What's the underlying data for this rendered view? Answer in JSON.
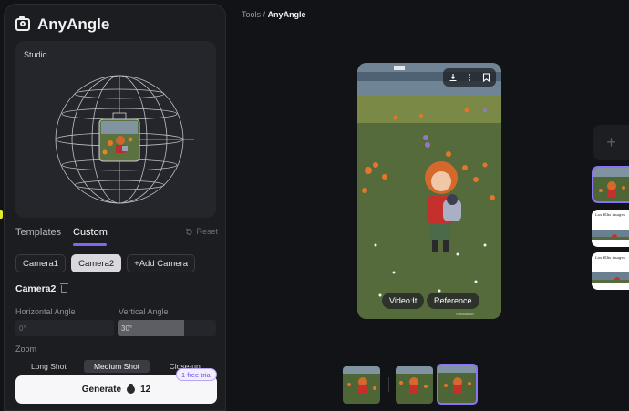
{
  "app": {
    "title": "AnyAngle"
  },
  "studio": {
    "label": "Studio"
  },
  "tabs": [
    {
      "label": "Templates"
    },
    {
      "label": "Custom"
    }
  ],
  "reset_label": "Reset",
  "cameras": [
    {
      "label": "Camera1"
    },
    {
      "label": "Camera2"
    },
    {
      "label": "+Add Camera"
    }
  ],
  "selected_camera": "Camera2",
  "horizontal": {
    "label": "Horizontal Angle",
    "value": "0°"
  },
  "vertical": {
    "label": "Vertical Angle",
    "value": "30°",
    "fill_fraction": 0.68
  },
  "zoom": {
    "label": "Zoom",
    "options": [
      "Long Shot",
      "Medium Shot",
      "Close-up"
    ],
    "selected": "Medium Shot"
  },
  "generate": {
    "label": "Generate",
    "cost": "12",
    "badge": "1 free trial"
  },
  "breadcrumb": {
    "root": "Tools",
    "sep": "/",
    "current": "AnyAngle"
  },
  "preview_actions": [
    {
      "label": "Video It"
    },
    {
      "label": "Reference"
    }
  ],
  "watermark": "© hoooooo",
  "right_thumbs": [
    {
      "caption": ""
    },
    {
      "caption": "Los Ellis images"
    },
    {
      "caption": "Los Ellis images"
    }
  ],
  "colors": {
    "accent": "#8167f0",
    "panel": "#1c1d21",
    "bg": "#121316"
  }
}
